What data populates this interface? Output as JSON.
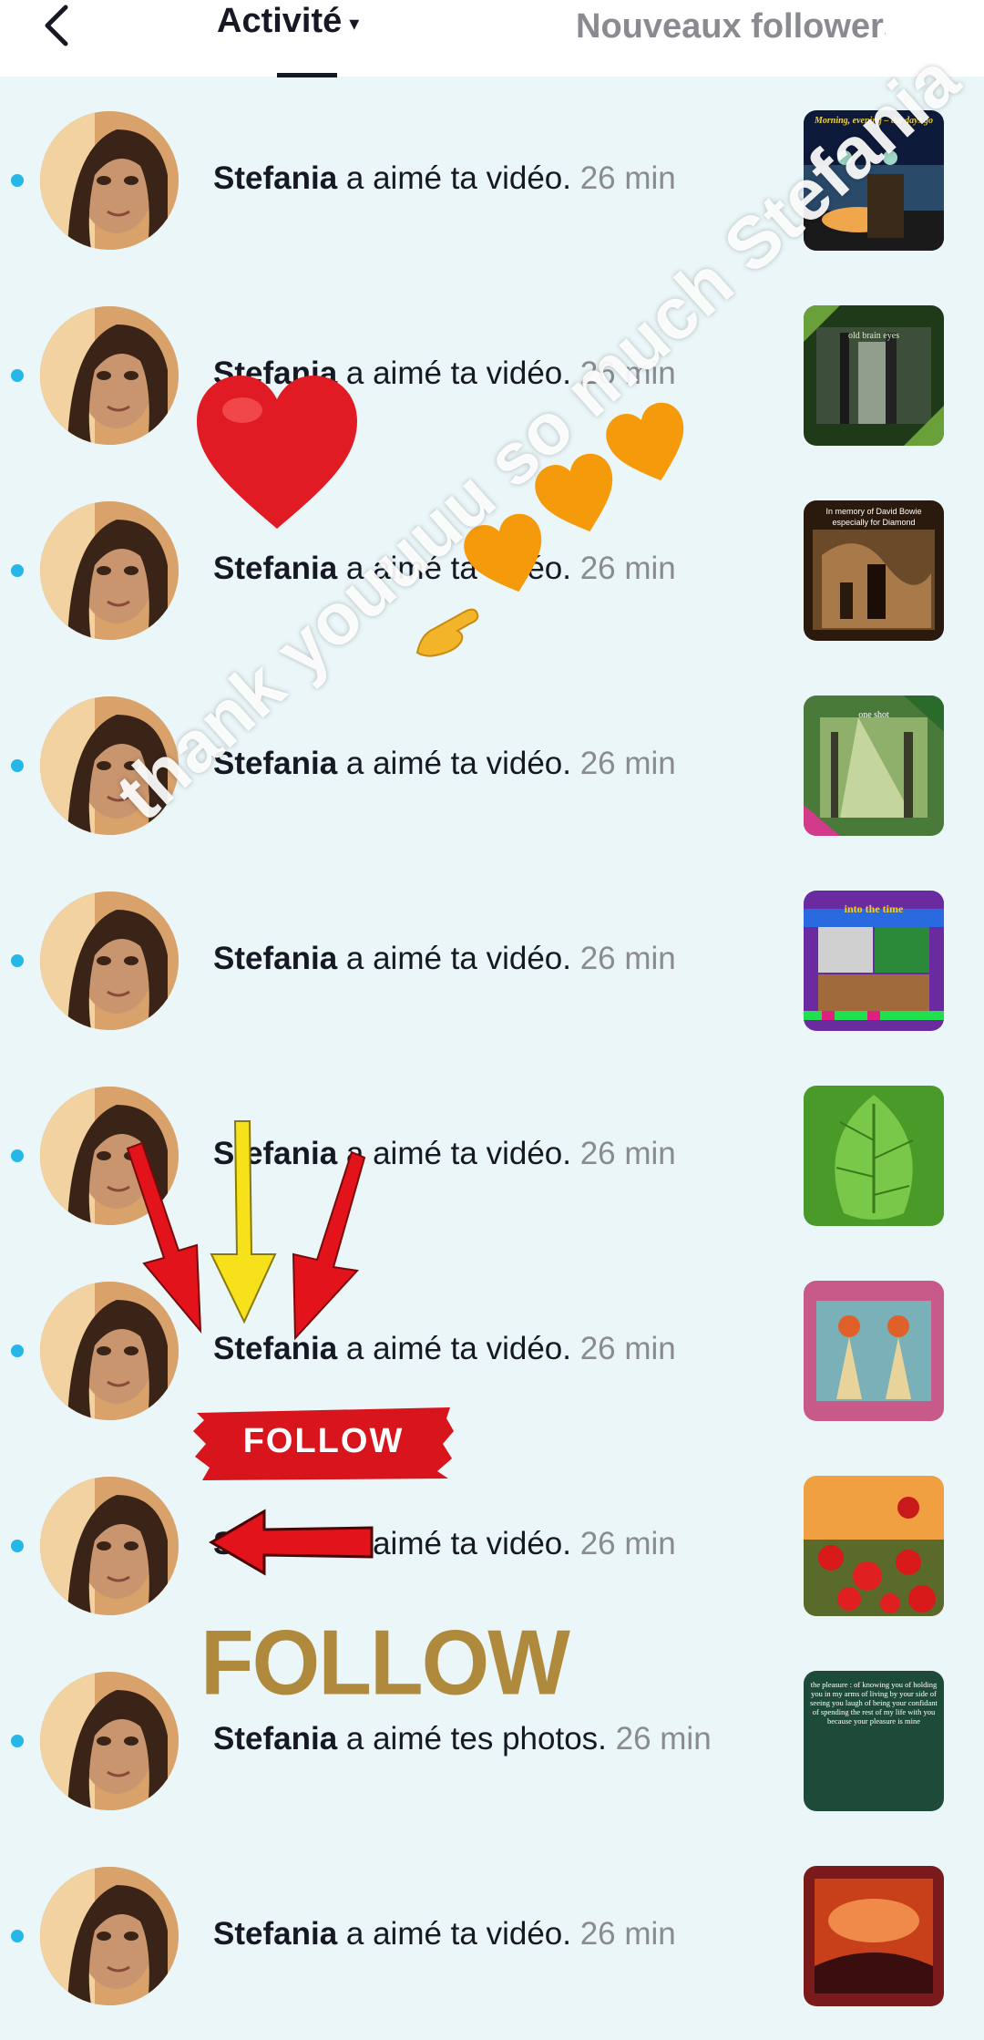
{
  "header": {
    "back_icon": "chevron-left-icon",
    "tab_active": "Activité",
    "tab_active_caret": "▾",
    "tab_inactive": "Nouveaux followers"
  },
  "notifications": [
    {
      "name": "Stefania",
      "action": "a aimé ta vidéo.",
      "time": "26 min",
      "thumb": "thumb-morning"
    },
    {
      "name": "Stefania",
      "action": "a aimé ta vidéo.",
      "time": "26 min",
      "thumb": "thumb-forest-dark"
    },
    {
      "name": "Stefania",
      "action": "a aimé ta vidéo.",
      "time": "26 min",
      "thumb": "thumb-bowie"
    },
    {
      "name": "Stefania",
      "action": "a aimé ta vidéo.",
      "time": "26 min",
      "thumb": "thumb-forest-light"
    },
    {
      "name": "Stefania",
      "action": "a aimé ta vidéo.",
      "time": "26 min",
      "thumb": "thumb-colorful"
    },
    {
      "name": "Stefania",
      "action": "a aimé ta vidéo.",
      "time": "26 min",
      "thumb": "thumb-leaf"
    },
    {
      "name": "Stefania",
      "action": "a aimé ta vidéo.",
      "time": "26 min",
      "thumb": "thumb-ladies"
    },
    {
      "name": "Stefania",
      "action": "a aimé ta vidéo.",
      "time": "26 min",
      "thumb": "thumb-poppies"
    },
    {
      "name": "Stefania",
      "action": "a aimé tes photos.",
      "time": "26 min",
      "thumb": "thumb-poem"
    },
    {
      "name": "Stefania",
      "action": "a aimé ta vidéo.",
      "time": "26 min",
      "thumb": "thumb-sunset"
    }
  ],
  "thumb_captions": {
    "morning": "Morning, evening – the days go",
    "forest_dark": "old brain eyes",
    "bowie": "In memory of David Bowie especially for Diamond",
    "forest_light": "one shot",
    "colorful": "into the time",
    "poem": "the pleasure : of knowing you of holding you in my arms of living by your side of seeing you laugh of being your confidant of spending the rest of my life with you because your pleasure is mine"
  },
  "overlay": {
    "watermark": "thank youuuu so much Stefania",
    "follow_sticker": "FOLLOW",
    "follow_gold": "FOLLOW"
  },
  "colors": {
    "unread_dot": "#25b7e8",
    "background": "#eaf6f8",
    "heart_red": "#e01b24",
    "heart_orange": "#f59a0b",
    "arrow_red": "#e3131b",
    "arrow_yellow": "#f6e11a",
    "follow_gold": "#b08a3c"
  }
}
